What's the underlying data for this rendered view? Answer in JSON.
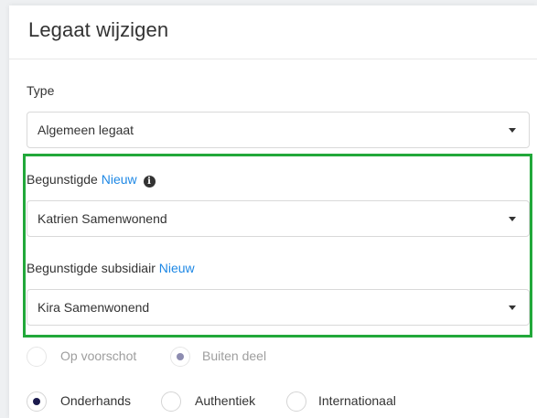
{
  "modal": {
    "title": "Legaat wijzigen"
  },
  "type_field": {
    "label": "Type",
    "value": "Algemeen legaat"
  },
  "beneficiary_field": {
    "label": "Begunstigde",
    "new_link": "Nieuw",
    "info_icon": "info-circle-icon",
    "value": "Katrien Samenwonend"
  },
  "subsidiary_field": {
    "label": "Begunstigde subsidiair",
    "new_link": "Nieuw",
    "value": "Kira Samenwonend"
  },
  "advance_radios": {
    "options": [
      {
        "label": "Op voorschot",
        "checked": false,
        "disabled": true
      },
      {
        "label": "Buiten deel",
        "checked": true,
        "disabled": true
      }
    ]
  },
  "deed_radios": {
    "options": [
      {
        "label": "Onderhands",
        "checked": true,
        "disabled": false
      },
      {
        "label": "Authentiek",
        "checked": false,
        "disabled": false
      },
      {
        "label": "Internationaal",
        "checked": false,
        "disabled": false
      }
    ]
  },
  "colors": {
    "highlight": "#22a83a",
    "link": "#1e88e5",
    "radio_checked": "#1b1a4d"
  }
}
